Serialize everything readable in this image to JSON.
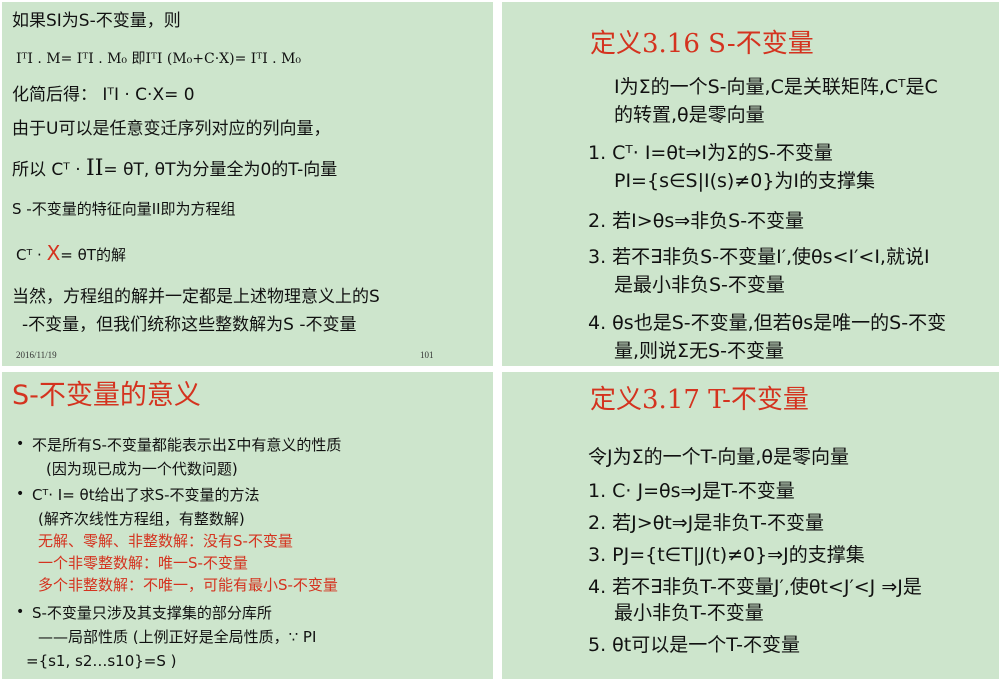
{
  "slide1": {
    "l1": "如果SI为S-不变量，则",
    "l2": "IᵀI . M= IᵀI . M₀ 即IᵀI (M₀+C·X)= IᵀI . M₀",
    "l3": "化简后得： IᵀI · C·X= 0",
    "l4": "由于U可以是任意变迁序列对应的列向量，",
    "l5a": "所以 Cᵀ · ",
    "l5b": "II",
    "l5c": "= θT, θT为分量全为0的T-向量",
    "l6": "S -不变量的特征向量II即为方程组",
    "l7a": "Cᵀ · ",
    "l7b": "X",
    "l7c": "= θT的解",
    "l8": "当然，方程组的解并一定都是上述物理意义上的S",
    "l9": "-不变量，但我们统称这些整数解为S -不变量",
    "date": "2016/11/19",
    "page": "101"
  },
  "slide2": {
    "title": "定义3.16 S-不变量",
    "p1": "I为Σ的一个S-向量,C是关联矩阵,Cᵀ是C",
    "p2": "的转置,θ是零向量",
    "i1": "1. Cᵀ· I=θt⇒I为Σ的S-不变量",
    "i1b": "PI={s∈S|I(s)≠0}为I的支撑集",
    "i2": "2. 若I>θs⇒非负S-不变量",
    "i3a": "3. 若不∃非负S-不变量I′,使θs<I′<I,就说I",
    "i3b": "是最小非负S-不变量",
    "i4a": "4. θs也是S-不变量,但若θs是唯一的S-不变",
    "i4b": "量,则说Σ无S-不变量"
  },
  "slide3": {
    "title": "S-不变量的意义",
    "b1": "不是所有S-不变量都能表示出Σ中有意义的性质",
    "b1b": "(因为现已成为一个代数问题)",
    "b2": "Cᵀ· I= θt给出了求S-不变量的方法",
    "b2b": "(解齐次线性方程组，有整数解)",
    "r1": "无解、零解、非整数解：没有S-不变量",
    "r2": "一个非零整数解：唯一S-不变量",
    "r3": "多个非整数解：不唯一，可能有最小S-不变量",
    "b3": "S-不变量只涉及其支撑集的部分库所",
    "b3b": "——局部性质 (上例正好是全局性质，∵ PI",
    "b3c": "={s1, s2…s10}=S )"
  },
  "slide4": {
    "title": "定义3.17 T-不变量",
    "p1": "令J为Σ的一个T-向量,θ是零向量",
    "i1": "1. C· J=θs⇒J是T-不变量",
    "i2": "2. 若J>θt⇒J是非负T-不变量",
    "i3": "3. PJ={t∈T|J(t)≠0}⇒J的支撑集",
    "i4a": "4. 若不∃非负T-不变量J′,使θt<J′<J ⇒J是",
    "i4b": "最小非负T-不变量",
    "i5": "5. θt可以是一个T-不变量"
  },
  "colors": {
    "background": "#cde5cc",
    "accent": "#d4331f"
  }
}
